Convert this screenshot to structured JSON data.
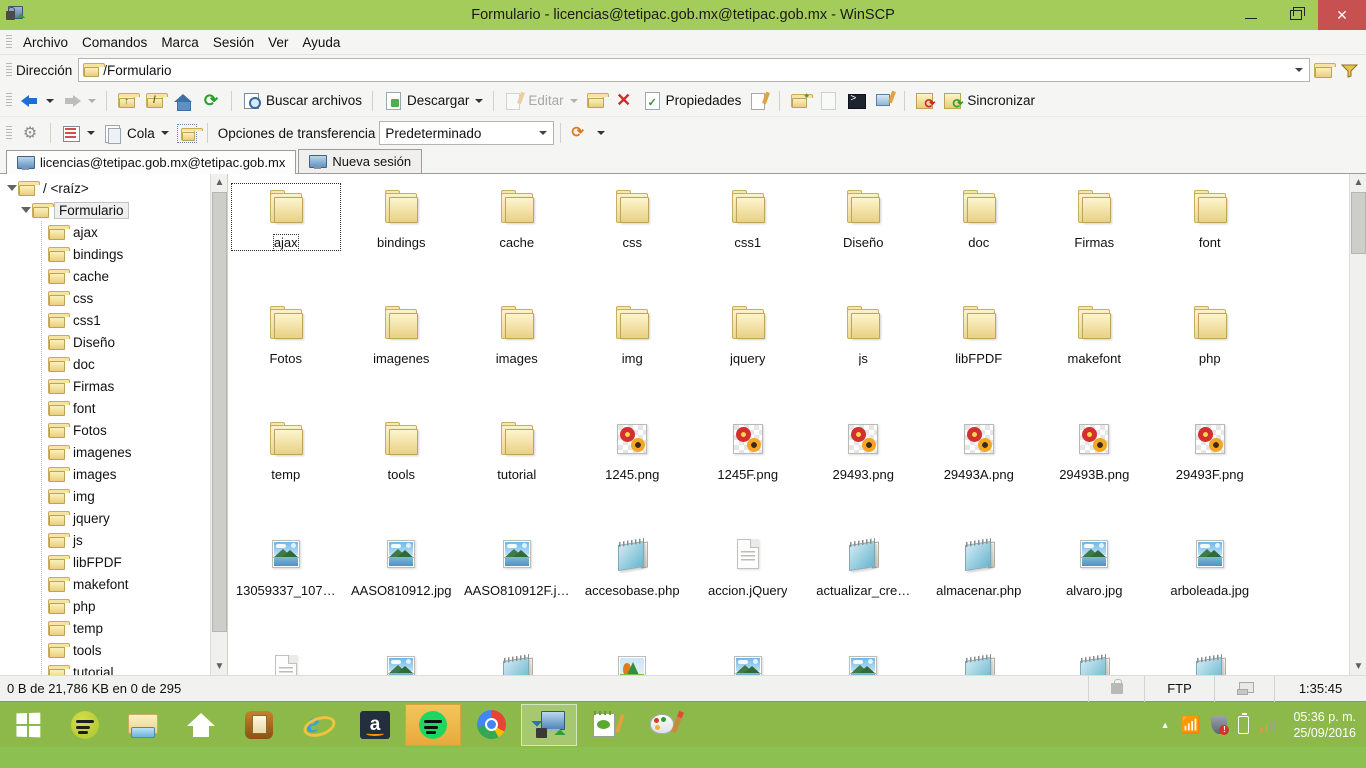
{
  "window": {
    "title": "Formulario - licencias@tetipac.gob.mx@tetipac.gob.mx - WinSCP",
    "app_icon": "winscp-lock-icon",
    "minimize_label": "Minimizar",
    "maximize_label": "Restaurar",
    "close_label": "Cerrar",
    "titlebar_color": "#a4cc5a",
    "close_color": "#c75050"
  },
  "menubar": {
    "items": [
      {
        "label": "Archivo"
      },
      {
        "label": "Comandos"
      },
      {
        "label": "Marca"
      },
      {
        "label": "Sesión"
      },
      {
        "label": "Ver"
      },
      {
        "label": "Ayuda"
      }
    ]
  },
  "addressbar": {
    "label": "Dirección",
    "path": "/Formulario",
    "folder_icon": "folder-icon",
    "dropdown_icon": "chevron-down-icon",
    "open_folder_button": "open-folder-icon",
    "filter_button": "filter-icon"
  },
  "toolbar_main": {
    "back_label": "Atrás",
    "forward_label": "Adelante",
    "parent_label": "Directorio padre",
    "root_label": "Directorio raíz",
    "home_label": "Inicio",
    "refresh_label": "Actualizar",
    "search_label": "Buscar archivos",
    "download_label": "Descargar",
    "edit_label": "Editar",
    "duplicate_label": "Duplicar",
    "delete_label": "Eliminar",
    "properties_label": "Propiedades",
    "rename_label": "Renombrar",
    "newdir_label": "Nuevo directorio",
    "newfile_label": "Nuevo archivo",
    "console_label": "Consola",
    "putty_label": "Abrir en PuTTY",
    "syncbrowse_label": "Examinar sincronizado",
    "sync_label": "Sincronizar"
  },
  "toolbar_transfer": {
    "preferences_label": "Preferencias",
    "view_label": "Vista",
    "queue_label": "Cola",
    "queue_settings_label": "Ajustes de cola",
    "transfer_options_label": "Opciones de transferencia",
    "transfer_preset": "Predeterminado",
    "refresh_session_label": "Refrescar sesión"
  },
  "tabs": [
    {
      "label": "licencias@tetipac.gob.mx@tetipac.gob.mx",
      "icon": "monitor-icon",
      "active": true
    },
    {
      "label": "Nueva sesión",
      "icon": "new-session-icon",
      "active": false
    }
  ],
  "tree": {
    "nodes": [
      {
        "label": "/ <raíz>",
        "indent": 0,
        "expanded": true,
        "selected": false
      },
      {
        "label": "Formulario",
        "indent": 1,
        "expanded": true,
        "selected": true
      },
      {
        "label": "ajax",
        "indent": 2,
        "expanded": false,
        "selected": false
      },
      {
        "label": "bindings",
        "indent": 2,
        "expanded": false,
        "selected": false
      },
      {
        "label": "cache",
        "indent": 2,
        "expanded": false,
        "selected": false
      },
      {
        "label": "css",
        "indent": 2,
        "expanded": false,
        "selected": false
      },
      {
        "label": "css1",
        "indent": 2,
        "expanded": false,
        "selected": false
      },
      {
        "label": "Diseño",
        "indent": 2,
        "expanded": false,
        "selected": false
      },
      {
        "label": "doc",
        "indent": 2,
        "expanded": false,
        "selected": false
      },
      {
        "label": "Firmas",
        "indent": 2,
        "expanded": false,
        "selected": false
      },
      {
        "label": "font",
        "indent": 2,
        "expanded": false,
        "selected": false
      },
      {
        "label": "Fotos",
        "indent": 2,
        "expanded": false,
        "selected": false
      },
      {
        "label": "imagenes",
        "indent": 2,
        "expanded": false,
        "selected": false
      },
      {
        "label": "images",
        "indent": 2,
        "expanded": false,
        "selected": false
      },
      {
        "label": "img",
        "indent": 2,
        "expanded": false,
        "selected": false
      },
      {
        "label": "jquery",
        "indent": 2,
        "expanded": false,
        "selected": false
      },
      {
        "label": "js",
        "indent": 2,
        "expanded": false,
        "selected": false
      },
      {
        "label": "libFPDF",
        "indent": 2,
        "expanded": false,
        "selected": false
      },
      {
        "label": "makefont",
        "indent": 2,
        "expanded": false,
        "selected": false
      },
      {
        "label": "php",
        "indent": 2,
        "expanded": false,
        "selected": false
      },
      {
        "label": "temp",
        "indent": 2,
        "expanded": false,
        "selected": false
      },
      {
        "label": "tools",
        "indent": 2,
        "expanded": false,
        "selected": false
      },
      {
        "label": "tutorial",
        "indent": 2,
        "expanded": false,
        "selected": false
      }
    ]
  },
  "files": [
    {
      "name": "ajax",
      "type": "folder",
      "selected": true
    },
    {
      "name": "bindings",
      "type": "folder",
      "selected": false
    },
    {
      "name": "cache",
      "type": "folder",
      "selected": false
    },
    {
      "name": "css",
      "type": "folder",
      "selected": false
    },
    {
      "name": "css1",
      "type": "folder",
      "selected": false
    },
    {
      "name": "Diseño",
      "type": "folder",
      "selected": false
    },
    {
      "name": "doc",
      "type": "folder",
      "selected": false
    },
    {
      "name": "Firmas",
      "type": "folder",
      "selected": false
    },
    {
      "name": "font",
      "type": "folder",
      "selected": false
    },
    {
      "name": "Fotos",
      "type": "folder",
      "selected": false
    },
    {
      "name": "imagenes",
      "type": "folder",
      "selected": false
    },
    {
      "name": "images",
      "type": "folder",
      "selected": false
    },
    {
      "name": "img",
      "type": "folder",
      "selected": false
    },
    {
      "name": "jquery",
      "type": "folder",
      "selected": false
    },
    {
      "name": "js",
      "type": "folder",
      "selected": false
    },
    {
      "name": "libFPDF",
      "type": "folder",
      "selected": false
    },
    {
      "name": "makefont",
      "type": "folder",
      "selected": false
    },
    {
      "name": "php",
      "type": "folder",
      "selected": false
    },
    {
      "name": "temp",
      "type": "folder",
      "selected": false
    },
    {
      "name": "tools",
      "type": "folder",
      "selected": false
    },
    {
      "name": "tutorial",
      "type": "folder",
      "selected": false
    },
    {
      "name": "1245.png",
      "type": "png",
      "selected": false
    },
    {
      "name": "1245F.png",
      "type": "png",
      "selected": false
    },
    {
      "name": "29493.png",
      "type": "png",
      "selected": false
    },
    {
      "name": "29493A.png",
      "type": "png",
      "selected": false
    },
    {
      "name": "29493B.png",
      "type": "png",
      "selected": false
    },
    {
      "name": "29493F.png",
      "type": "png",
      "selected": false
    },
    {
      "name": "13059337_107…",
      "type": "jpg",
      "selected": false
    },
    {
      "name": "AASO810912.jpg",
      "type": "jpg",
      "selected": false
    },
    {
      "name": "AASO810912F.j…",
      "type": "jpg",
      "selected": false
    },
    {
      "name": "accesobase.php",
      "type": "php",
      "selected": false
    },
    {
      "name": "accion.jQuery",
      "type": "doc",
      "selected": false
    },
    {
      "name": "actualizar_cre…",
      "type": "php",
      "selected": false
    },
    {
      "name": "almacenar.php",
      "type": "php",
      "selected": false
    },
    {
      "name": "alvaro.jpg",
      "type": "jpg",
      "selected": false
    },
    {
      "name": "arboleada.jpg",
      "type": "jpg",
      "selected": false
    }
  ],
  "files_partial_row": [
    {
      "name": "",
      "type": "doc"
    },
    {
      "name": "",
      "type": "jpg"
    },
    {
      "name": "",
      "type": "php"
    },
    {
      "name": "",
      "type": "scene"
    },
    {
      "name": "",
      "type": "jpg"
    },
    {
      "name": "",
      "type": "jpg"
    },
    {
      "name": "",
      "type": "php"
    },
    {
      "name": "",
      "type": "php"
    },
    {
      "name": "",
      "type": "php"
    }
  ],
  "statusbar": {
    "selection": "0 B de 21,786 KB en 0 de 295",
    "security_icon": "lock-icon",
    "protocol": "FTP",
    "network_icon": "network-icon",
    "session_time": "1:35:45"
  },
  "taskbar": {
    "start_label": "Inicio",
    "items": [
      {
        "name": "spotify-taskbar-icon",
        "state": "pinned"
      },
      {
        "name": "file-explorer-icon",
        "state": "pinned"
      },
      {
        "name": "home-icon",
        "state": "pinned"
      },
      {
        "name": "notepad-orange-icon",
        "state": "pinned"
      },
      {
        "name": "internet-explorer-icon",
        "state": "pinned"
      },
      {
        "name": "amazon-icon",
        "state": "pinned"
      },
      {
        "name": "spotify-running-icon",
        "state": "hot"
      },
      {
        "name": "chrome-icon",
        "state": "running"
      },
      {
        "name": "winscp-icon",
        "state": "active"
      },
      {
        "name": "notepadpp-icon",
        "state": "running"
      },
      {
        "name": "paint-icon",
        "state": "running"
      }
    ],
    "tray": {
      "show_hidden_icon": "chevron-up-icon",
      "wifi_icon": "wifi-icon",
      "security_icon": "shield-warning-icon",
      "battery_icon": "battery-icon",
      "signal_icon": "signal-bars-icon",
      "time": "05:36 p. m.",
      "date": "25/09/2016"
    }
  }
}
